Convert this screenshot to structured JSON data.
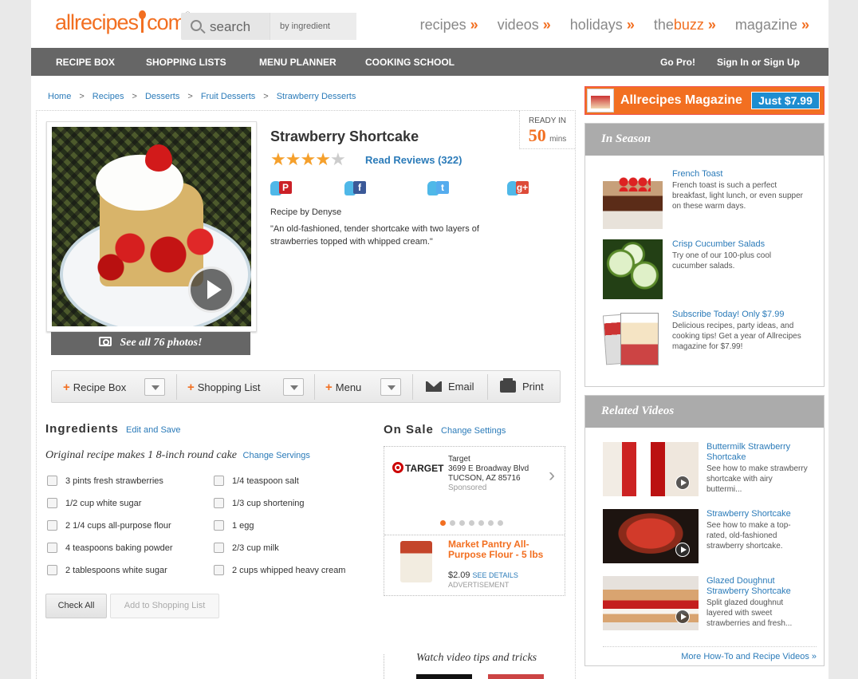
{
  "header": {
    "logo": "allrecipes",
    "logo_suffix": "com",
    "search_placeholder": "search",
    "search_mode": "by ingredient",
    "nav": [
      {
        "label": "recipes",
        "arrow": "»"
      },
      {
        "label": "videos",
        "arrow": "»"
      },
      {
        "label": "holidays",
        "arrow": "»"
      },
      {
        "label_prefix": "the",
        "label_highlight": "buzz",
        "arrow": "»"
      },
      {
        "label": "magazine",
        "arrow": "»"
      }
    ]
  },
  "navbar": {
    "items": [
      "RECIPE BOX",
      "SHOPPING LISTS",
      "MENU PLANNER",
      "COOKING SCHOOL"
    ],
    "right": [
      "Go Pro!",
      "Sign In or Sign Up"
    ]
  },
  "breadcrumb": [
    "Home",
    "Recipes",
    "Desserts",
    "Fruit Desserts",
    "Strawberry Desserts"
  ],
  "breadcrumb_sep": ">",
  "recipe": {
    "title": "Strawberry Shortcake",
    "ready_label": "READY IN",
    "ready_value": "50",
    "ready_unit": "mins",
    "rating": 4,
    "rating_max": 5,
    "reviews_label": "Read Reviews",
    "reviews_count": "(322)",
    "see_photos": "See all 76 photos!",
    "byline": "Recipe by Denyse",
    "description": "\"An old-fashioned, tender shortcake with two layers of strawberries topped with whipped cream.\"",
    "share": [
      {
        "icon": "pinterest-icon",
        "glyph": "P",
        "color": "#cb2027"
      },
      {
        "icon": "facebook-icon",
        "glyph": "f",
        "color": "#3b5998"
      },
      {
        "icon": "twitter-icon",
        "glyph": "t",
        "color": "#55acee"
      },
      {
        "icon": "google-plus-icon",
        "glyph": "g+",
        "color": "#dd4b39"
      }
    ]
  },
  "toolbar": {
    "recipe_box": "Recipe Box",
    "shopping_list": "Shopping List",
    "menu": "Menu",
    "email": "Email",
    "print": "Print",
    "plus": "+"
  },
  "ingredients": {
    "heading": "Ingredients",
    "edit_link": "Edit and Save",
    "original": "Original recipe makes 1 8-inch round cake",
    "change_servings": "Change Servings",
    "left": [
      "3 pints fresh strawberries",
      "1/2 cup white sugar",
      "2 1/4 cups all-purpose flour",
      "4 teaspoons baking powder",
      "2 tablespoons white sugar"
    ],
    "right": [
      "1/4 teaspoon salt",
      "1/3 cup shortening",
      "1 egg",
      "2/3 cup milk",
      "2 cups whipped heavy cream"
    ],
    "check_all": "Check All",
    "add_to_list": "Add to Shopping List"
  },
  "on_sale": {
    "heading": "On Sale",
    "change_settings": "Change Settings",
    "store_logo": "TARGET",
    "store_name": "Target",
    "store_address1": "3699 E Broadway Blvd",
    "store_address2": "TUCSON, AZ 85716",
    "sponsored": "Sponsored",
    "next": "›",
    "dots_total": 7,
    "dots_active": 0,
    "product_name": "Market Pantry All-Purpose Flour - 5 lbs",
    "product_price": "$2.09",
    "see_details": "SEE DETAILS",
    "advertisement": "ADVERTISEMENT"
  },
  "watch_tips": "Watch video tips and tricks",
  "magazine_ad": {
    "text": "Allrecipes Magazine",
    "price": "Just $7.99"
  },
  "in_season": {
    "heading": "In Season",
    "items": [
      {
        "title": "French Toast",
        "desc": "French toast is such a perfect breakfast, light lunch, or even supper on these warm days."
      },
      {
        "title": "Crisp Cucumber Salads",
        "desc": "Try one of our 100-plus cool cucumber salads."
      },
      {
        "title": "Subscribe Today! Only $7.99",
        "desc": "Delicious recipes, party ideas, and cooking tips! Get a year of Allrecipes magazine for $7.99!"
      }
    ]
  },
  "related_videos": {
    "heading": "Related Videos",
    "items": [
      {
        "title": "Buttermilk Strawberry Shortcake",
        "desc": "See how to make strawberry shortcake with airy buttermi..."
      },
      {
        "title": "Strawberry Shortcake",
        "desc": "See how to make a top-rated, old-fashioned strawberry shortcake."
      },
      {
        "title": "Glazed Doughnut Strawberry Shortcake",
        "desc": "Split glazed doughnut layered with sweet strawberries and fresh..."
      }
    ],
    "more": "More How-To and Recipe Videos »"
  },
  "colors": {
    "accent": "#f26f21",
    "link": "#2b7bb9",
    "navbar": "#666666",
    "panel_header": "#ababab"
  }
}
